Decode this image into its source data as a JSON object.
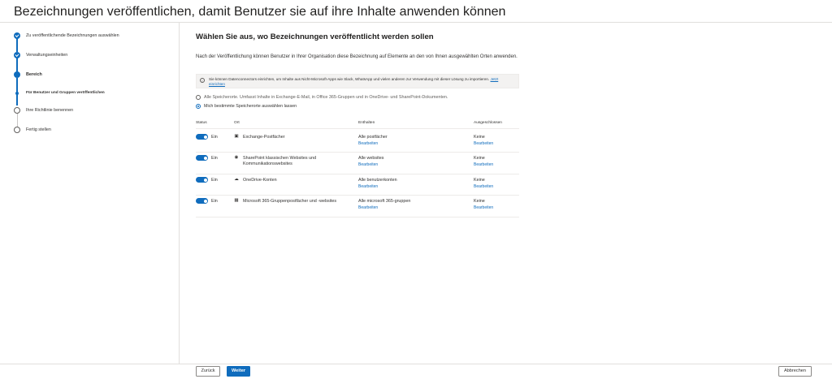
{
  "page": {
    "title": "Bezeichnungen veröffentlichen, damit Benutzer sie auf ihre Inhalte anwenden können"
  },
  "colors": {
    "accent": "#0f6cbd",
    "text": "#201f1e",
    "divider": "#e1dfdd"
  },
  "steps": [
    {
      "label": "Zu veröffentlichende Bezeichnungen auswählen",
      "state": "done"
    },
    {
      "label": "Verwaltungseinheiten",
      "state": "done"
    },
    {
      "label": "Bereich",
      "state": "current"
    },
    {
      "label": "Für Benutzer und Gruppen veröffentlichen",
      "state": "current-sub"
    },
    {
      "label": "Ihre Richtlinie benennen",
      "state": "open"
    },
    {
      "label": "Fertig stellen",
      "state": "open"
    }
  ],
  "main": {
    "heading": "Wählen Sie aus, wo Bezeichnungen veröffentlicht werden sollen",
    "intro": "Nach der Veröffentlichung können Benutzer in Ihrer Organisation diese Bezeichnung auf Elemente an den von Ihnen ausgewählten Orten anwenden.",
    "info": {
      "icon": "info-icon",
      "text": "Sie können Datenconnectors einrichten, um Inhalte aus Nicht-Microsoft-Apps wie Slack, WhatsApp und vielen anderen zur Verwendung mit dieser Lösung zu importieren.",
      "link": "Jetzt einrichten"
    },
    "options": [
      {
        "label": "Alle Speicherorte. Umfasst Inhalte in Exchange-E-Mail, in Office 365-Gruppen und in OneDrive- und SharePoint-Dokumenten.",
        "selected": false
      },
      {
        "label": "Mich bestimmte Speicherorte auswählen lassen",
        "selected": true
      }
    ],
    "table": {
      "headers": {
        "status": "Status",
        "location": "Ort",
        "included": "Enthalten",
        "excluded": "Ausgeschlossen"
      },
      "rows": [
        {
          "status": "Ein",
          "icon": "exchange-icon",
          "location": "Exchange-Postfächer",
          "included": "Alle postfächer",
          "included_edit": "Bearbeiten",
          "excluded": "Keine",
          "excluded_edit": "Bearbeiten"
        },
        {
          "status": "Ein",
          "icon": "sharepoint-icon",
          "location": "SharePoint klassischen Websites und Kommunikationswebsites",
          "included": "Alle websites",
          "included_edit": "Bearbeiten",
          "excluded": "Keine",
          "excluded_edit": "Bearbeiten"
        },
        {
          "status": "Ein",
          "icon": "onedrive-icon",
          "location": "OneDrive-Konten",
          "included": "Alle benutzerkonten",
          "included_edit": "Bearbeiten",
          "excluded": "Keine",
          "excluded_edit": "Bearbeiten"
        },
        {
          "status": "Ein",
          "icon": "groups-icon",
          "location": "Microsoft 365-Gruppenpostfächer und -websites",
          "included": "Alle microsoft 365-gruppen",
          "included_edit": "Bearbeiten",
          "excluded": "Keine",
          "excluded_edit": "Bearbeiten"
        }
      ]
    }
  },
  "footer": {
    "back": "Zurück",
    "next": "Weiter",
    "cancel": "Abbrechen"
  }
}
